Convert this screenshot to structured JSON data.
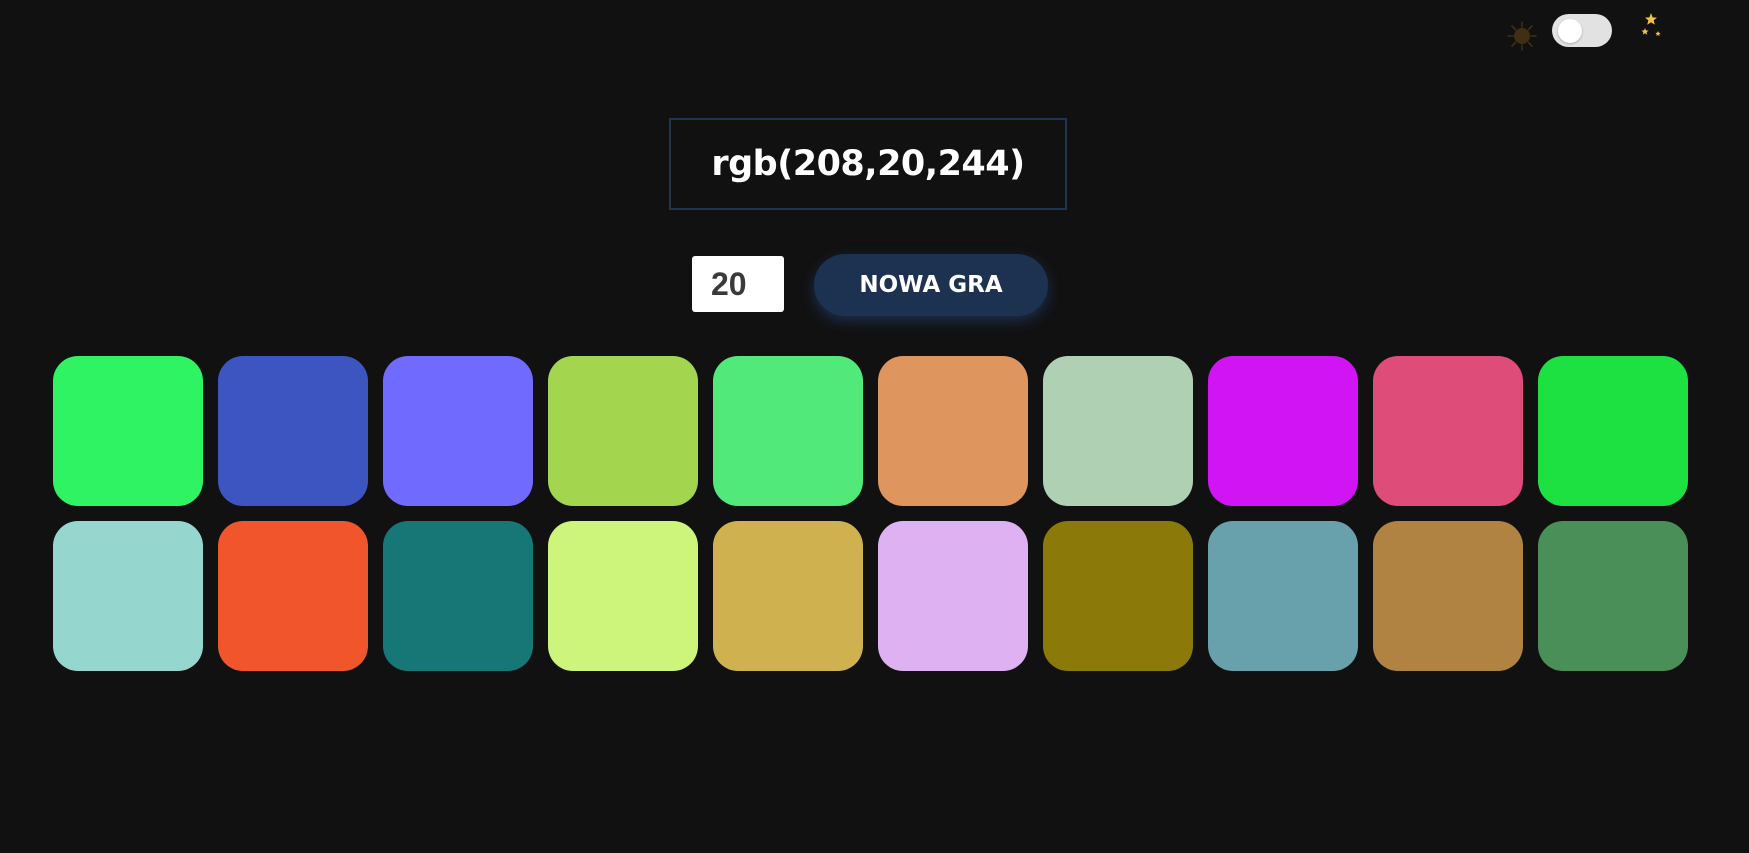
{
  "theme_switch": {
    "sun_icon": "sun-icon",
    "moon_icon": "moon-stars-icon",
    "dark_mode": false,
    "colors": {
      "sun": "#3f2f14",
      "moon": "#3d8fd6",
      "stars": "#f3c24a",
      "track": "#e2e2e2"
    }
  },
  "target": {
    "color_text": "rgb(208,20,244)"
  },
  "controls": {
    "tile_count": "20",
    "new_game_label": "NOWA GRA"
  },
  "swatches": [
    "#2ff363",
    "#3d55c1",
    "#716afe",
    "#a4d54e",
    "#51e97a",
    "#de955e",
    "#b0d0b3",
    "#d014f4",
    "#de4c7a",
    "#1de141",
    "#95d7ce",
    "#f0552b",
    "#167776",
    "#cdf47b",
    "#d0b150",
    "#ddb1f2",
    "#8b790a",
    "#68a0ab",
    "#b08342",
    "#4b8f58"
  ]
}
